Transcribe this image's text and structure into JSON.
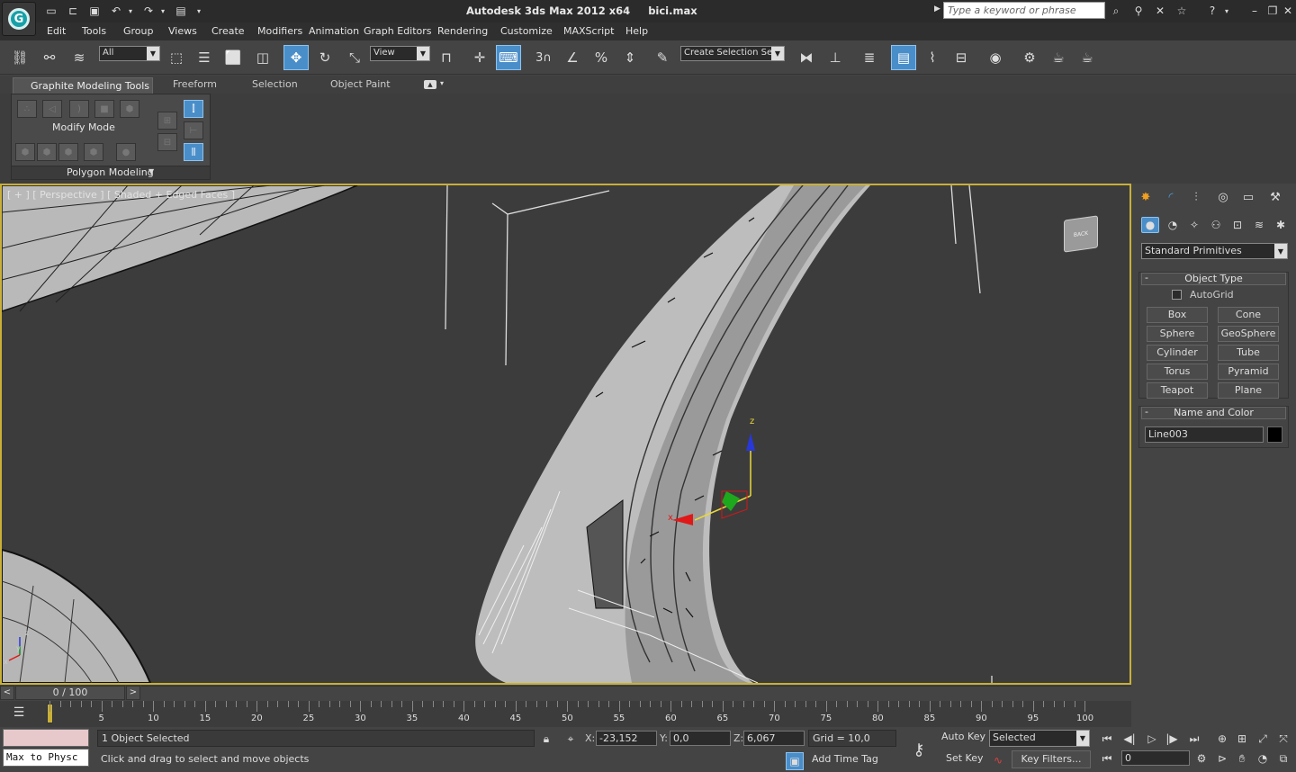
{
  "title": {
    "app": "Autodesk 3ds Max  2012 x64",
    "file": "bici.max"
  },
  "search": {
    "placeholder": "Type a keyword or phrase"
  },
  "menu": [
    "Edit",
    "Tools",
    "Group",
    "Views",
    "Create",
    "Modifiers",
    "Animation",
    "Graph Editors",
    "Rendering",
    "Customize",
    "MAXScript",
    "Help"
  ],
  "toolbar": {
    "filter": "All",
    "ref_coord": "View",
    "selection_set": "Create Selection Se"
  },
  "ribbon": {
    "tabs": [
      "Graphite Modeling Tools",
      "Freeform",
      "Selection",
      "Object Paint"
    ],
    "panel_mode": "Modify Mode",
    "panel_footer": "Polygon Modeling"
  },
  "viewport": {
    "label": "[ + ] [ Perspective ] [ Shaded + Edged Faces ]",
    "viewcube": "BACK",
    "gizmo_z": "z",
    "gizmo_x": "x",
    "axis_z": "z",
    "axis_y": "y",
    "axis_x": "x"
  },
  "command_panel": {
    "category": "Standard Primitives",
    "object_type": {
      "header": "Object Type",
      "autogrid": "AutoGrid",
      "buttons": [
        "Box",
        "Cone",
        "Sphere",
        "GeoSphere",
        "Cylinder",
        "Tube",
        "Torus",
        "Pyramid",
        "Teapot",
        "Plane"
      ]
    },
    "name_color": {
      "header": "Name and Color",
      "name": "Line003",
      "color": "#000000"
    }
  },
  "timeline": {
    "frame": "0 / 100",
    "ticks": [
      "5",
      "10",
      "15",
      "20",
      "25",
      "30",
      "35",
      "40",
      "45",
      "50",
      "55",
      "60",
      "65",
      "70",
      "75",
      "80",
      "85",
      "90",
      "95",
      "100"
    ]
  },
  "status": {
    "maxscript": "Max to Physc",
    "selected": "1 Object Selected",
    "prompt": "Click and drag to select and move objects",
    "x": "-23,152",
    "y": "0,0",
    "z": "6,067",
    "grid": "Grid = 10,0",
    "add_time_tag": "Add Time Tag",
    "auto_key": "Auto Key",
    "set_key": "Set Key",
    "key_mode": "Selected",
    "key_filters": "Key Filters...",
    "frame_field": "0",
    "x_label": "X:",
    "y_label": "Y:",
    "z_label": "Z:"
  }
}
